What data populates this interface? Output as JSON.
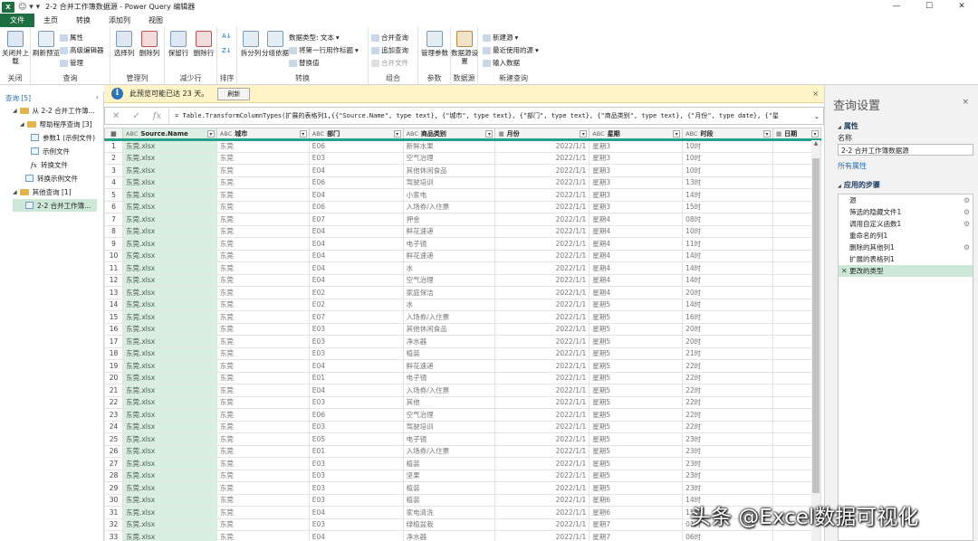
{
  "window": {
    "quick_access": "☺ ▾ ▾",
    "title": "2-2 合并工作簿数据源 - Power Query 编辑器",
    "controls": [
      "—",
      "☐",
      "✕"
    ]
  },
  "tabs": [
    "文件",
    "主页",
    "转换",
    "添加列",
    "视图"
  ],
  "ribbon": {
    "close": {
      "label": "关闭并上载",
      "group": "关闭"
    },
    "query": {
      "refresh": "刷新预览",
      "properties": "属性",
      "advanced_editor": "高级编辑器",
      "manage": "管理",
      "group": "查询"
    },
    "manage_cols": {
      "choose": "选择列",
      "remove": "删除列",
      "group": "管理列"
    },
    "reduce": {
      "keep": "保留行",
      "remove": "删除行",
      "group": "减少行"
    },
    "sort": {
      "group": "排序"
    },
    "transform": {
      "split": "拆分列",
      "groupby": "分组依据",
      "datatype": "数据类型: 文本",
      "first_row": "将第一行用作标题",
      "replace": "替换值",
      "group": "转换"
    },
    "combine": {
      "merge": "合并查询",
      "append": "追加查询",
      "files": "合并文件",
      "group": "组合"
    },
    "params": {
      "manage": "管理参数",
      "group": "参数"
    },
    "datasource": {
      "settings": "数据源设置",
      "group": "数据源"
    },
    "newquery": {
      "new_source": "新建源",
      "recent": "最近使用的源",
      "enter": "输入数据",
      "group": "新建查询"
    }
  },
  "notification": {
    "message": "此预览可能已达 23 天。",
    "button": "刷新",
    "close": "×"
  },
  "formula": {
    "text": "= Table.TransformColumnTypes(扩展的表格列1,{{\"Source.Name\", type text}, {\"城市\", type text}, {\"部门\", type text}, {\"商品类别\", type text}, {\"月份\", type date}, {\"星"
  },
  "nav": {
    "header": "查询 [5]",
    "items": [
      "从 2-2 合并工作簿...",
      "帮助程序查询 [3]",
      "参数1 (示例文件)",
      "示例文件",
      "转换文件",
      "转换示例文件",
      "其他查询 [1]",
      "2-2 合并工作簿..."
    ]
  },
  "table": {
    "columns": [
      {
        "type": "ABC",
        "name": "Source.Name"
      },
      {
        "type": "ABC",
        "name": "城市"
      },
      {
        "type": "ABC",
        "name": "部门"
      },
      {
        "type": "ABC",
        "name": "商品类别"
      },
      {
        "type": "▦",
        "name": "月份"
      },
      {
        "type": "ABC",
        "name": "星期"
      },
      {
        "type": "ABC",
        "name": "时段"
      },
      {
        "type": "▦",
        "name": "日期"
      }
    ],
    "rows": [
      [
        "1",
        "东莞.xlsx",
        "东莞",
        "E06",
        "新鲜水果",
        "2022/1/1",
        "星期3",
        "10时"
      ],
      [
        "2",
        "东莞.xlsx",
        "东莞",
        "E03",
        "空气治理",
        "2022/1/1",
        "星期3",
        "10时"
      ],
      [
        "3",
        "东莞.xlsx",
        "东莞",
        "E04",
        "其他休闲食品",
        "2022/1/1",
        "星期3",
        "10时"
      ],
      [
        "4",
        "东莞.xlsx",
        "东莞",
        "E06",
        "驾驶培训",
        "2022/1/1",
        "星期3",
        "13时"
      ],
      [
        "5",
        "东莞.xlsx",
        "东莞",
        "E04",
        "小家电",
        "2022/1/1",
        "星期3",
        "14时"
      ],
      [
        "6",
        "东莞.xlsx",
        "东莞",
        "E06",
        "入场券/入住票",
        "2022/1/1",
        "星期3",
        "15时"
      ],
      [
        "7",
        "东莞.xlsx",
        "东莞",
        "E07",
        "押金",
        "2022/1/1",
        "星期4",
        "08时"
      ],
      [
        "8",
        "东莞.xlsx",
        "东莞",
        "E04",
        "鲜花速递",
        "2022/1/1",
        "星期4",
        "10时"
      ],
      [
        "9",
        "东莞.xlsx",
        "东莞",
        "E04",
        "电子镜",
        "2022/1/1",
        "星期4",
        "11时"
      ],
      [
        "10",
        "东莞.xlsx",
        "东莞",
        "E04",
        "鲜花速递",
        "2022/1/1",
        "星期4",
        "14时"
      ],
      [
        "11",
        "东莞.xlsx",
        "东莞",
        "E04",
        "水",
        "2022/1/1",
        "星期4",
        "14时"
      ],
      [
        "12",
        "东莞.xlsx",
        "东莞",
        "E04",
        "空气治理",
        "2022/1/1",
        "星期4",
        "14时"
      ],
      [
        "13",
        "东莞.xlsx",
        "东莞",
        "E02",
        "家庭保洁",
        "2022/1/1",
        "星期4",
        "20时"
      ],
      [
        "14",
        "东莞.xlsx",
        "东莞",
        "E02",
        "水",
        "2022/1/1",
        "星期5",
        "14时"
      ],
      [
        "15",
        "东莞.xlsx",
        "东莞",
        "E07",
        "入场券/入住票",
        "2022/1/1",
        "星期5",
        "16时"
      ],
      [
        "16",
        "东莞.xlsx",
        "东莞",
        "E03",
        "其他休闲食品",
        "2022/1/1",
        "星期5",
        "20时"
      ],
      [
        "17",
        "东莞.xlsx",
        "东莞",
        "E03",
        "净水器",
        "2022/1/1",
        "星期5",
        "20时"
      ],
      [
        "18",
        "东莞.xlsx",
        "东莞",
        "E03",
        "植装",
        "2022/1/1",
        "星期5",
        "21时"
      ],
      [
        "19",
        "东莞.xlsx",
        "东莞",
        "E04",
        "鲜花速递",
        "2022/1/1",
        "星期5",
        "22时"
      ],
      [
        "20",
        "东莞.xlsx",
        "东莞",
        "E01",
        "电子镜",
        "2022/1/1",
        "星期5",
        "22时"
      ],
      [
        "21",
        "东莞.xlsx",
        "东莞",
        "E04",
        "入场券/入住票",
        "2022/1/1",
        "星期5",
        "22时"
      ],
      [
        "22",
        "东莞.xlsx",
        "东莞",
        "E03",
        "其他",
        "2022/1/1",
        "星期5",
        "22时"
      ],
      [
        "23",
        "东莞.xlsx",
        "东莞",
        "E06",
        "空气治理",
        "2022/1/1",
        "星期5",
        "22时"
      ],
      [
        "24",
        "东莞.xlsx",
        "东莞",
        "E03",
        "驾驶培训",
        "2022/1/1",
        "星期5",
        "22时"
      ],
      [
        "25",
        "东莞.xlsx",
        "东莞",
        "E05",
        "电子镜",
        "2022/1/1",
        "星期5",
        "23时"
      ],
      [
        "26",
        "东莞.xlsx",
        "东莞",
        "E01",
        "入场券/入住票",
        "2022/1/1",
        "星期5",
        "23时"
      ],
      [
        "27",
        "东莞.xlsx",
        "东莞",
        "E03",
        "植装",
        "2022/1/1",
        "星期5",
        "23时"
      ],
      [
        "28",
        "东莞.xlsx",
        "东莞",
        "E03",
        "坚果",
        "2022/1/1",
        "星期5",
        "23时"
      ],
      [
        "29",
        "东莞.xlsx",
        "东莞",
        "E03",
        "植装",
        "2022/1/1",
        "星期5",
        "23时"
      ],
      [
        "30",
        "东莞.xlsx",
        "东莞",
        "E03",
        "植装",
        "2022/1/1",
        "星期6",
        "14时"
      ],
      [
        "31",
        "东莞.xlsx",
        "东莞",
        "E04",
        "家电清洗",
        "2022/1/1",
        "星期6",
        "15时"
      ],
      [
        "32",
        "东莞.xlsx",
        "东莞",
        "E03",
        "绿植盆栽",
        "2022/1/1",
        "星期7",
        "01时"
      ],
      [
        "33",
        "东莞.xlsx",
        "东莞",
        "E04",
        "净水器",
        "2022/1/1",
        "星期7",
        "06时"
      ]
    ]
  },
  "settings": {
    "title": "查询设置",
    "close": "×",
    "properties": "属性",
    "name_label": "名称",
    "name_value": "2-2 合并工作簿数据源",
    "all_props": "所有属性",
    "steps_title": "应用的步骤",
    "steps": [
      "源",
      "筛选的隐藏文件1",
      "调用自定义函数1",
      "重命名的列1",
      "删除的其他列1",
      "扩展的表格列1",
      "更改的类型"
    ]
  },
  "watermark": "头条 @Excel数据可视化"
}
